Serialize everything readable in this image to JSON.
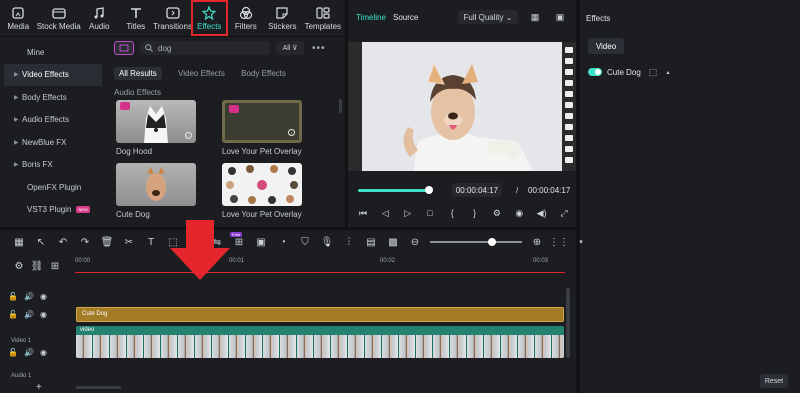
{
  "toolbar": {
    "items": [
      {
        "label": "Media",
        "icon": "media-icon"
      },
      {
        "label": "Stock Media",
        "icon": "stock-media-icon"
      },
      {
        "label": "Audio",
        "icon": "audio-icon"
      },
      {
        "label": "Titles",
        "icon": "titles-icon"
      },
      {
        "label": "Transitions",
        "icon": "transitions-icon"
      },
      {
        "label": "Effects",
        "icon": "effects-icon",
        "active": true
      },
      {
        "label": "Filters",
        "icon": "filters-icon"
      },
      {
        "label": "Stickers",
        "icon": "stickers-icon"
      },
      {
        "label": "Templates",
        "icon": "templates-icon"
      }
    ]
  },
  "sidebar": {
    "items": [
      {
        "label": "Mine"
      },
      {
        "label": "Video Effects"
      },
      {
        "label": "Body Effects"
      },
      {
        "label": "Audio Effects"
      },
      {
        "label": "NewBlue FX"
      },
      {
        "label": "Boris FX"
      },
      {
        "label": "OpenFX Plugin"
      },
      {
        "label": "VST3 Plugin",
        "badge": "NEW"
      }
    ]
  },
  "library": {
    "search_value": "dog",
    "filter_label": "All",
    "tabs": [
      "All Results",
      "Video Effects",
      "Body Effects",
      "Audio Effects"
    ],
    "cards": [
      {
        "label": "Dog Hood"
      },
      {
        "label": "Love Your Pet Overlay ..."
      },
      {
        "label": "Cute Dog"
      },
      {
        "label": "Love Your Pet Overlay ..."
      }
    ]
  },
  "player": {
    "tab_timeline": "Timeline",
    "tab_source": "Source",
    "quality": "Full Quality",
    "current_time": "00:00:04:17",
    "separator": "/",
    "total_time": "00:00:04:17",
    "progress": 0.95
  },
  "properties": {
    "title": "Effects",
    "tab": "Video",
    "effect_name": "Cute Dog",
    "reset_label": "Reset"
  },
  "timeline": {
    "ruler": [
      "00:00",
      "00:01",
      "00:02",
      "00:03"
    ],
    "clip_effect_label": "Cute Dog",
    "clip_video_label": "video",
    "track_video_label": "Video 1",
    "track_audio_label": "Audio 1",
    "ai_badge": "Free"
  },
  "colors": {
    "accent": "#3fe0c5",
    "highlight": "#e4262c",
    "effect_clip": "#a57c26",
    "video_clip": "#1d6f5f"
  }
}
